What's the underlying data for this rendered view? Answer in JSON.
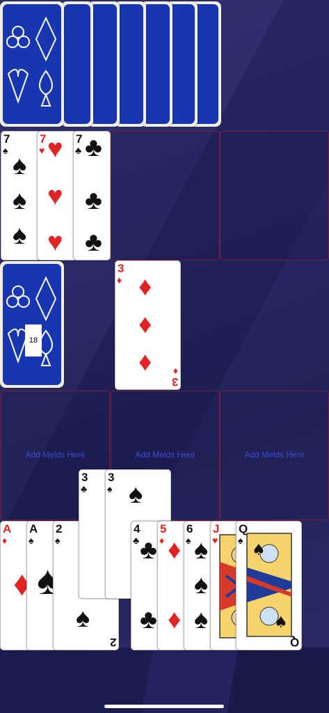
{
  "opponent": {
    "hand_card_count": 8
  },
  "melds": {
    "top_row": [
      {
        "cards": [
          {
            "rank": "7",
            "suit": "♠",
            "color": "black"
          },
          {
            "rank": "7",
            "suit": "♥",
            "color": "red"
          },
          {
            "rank": "7",
            "suit": "♣",
            "color": "black"
          }
        ]
      }
    ]
  },
  "stock": {
    "count": "18"
  },
  "discard": {
    "rank": "3",
    "suit": "♦",
    "color": "red"
  },
  "player_slots": [
    {
      "label": "Add Melds Here"
    },
    {
      "label": "Add Melds Here"
    },
    {
      "label": "Add Melds Here"
    }
  ],
  "hand": [
    {
      "rank": "A",
      "suit": "♦",
      "color": "red"
    },
    {
      "rank": "A",
      "suit": "♠",
      "color": "black"
    },
    {
      "rank": "2",
      "suit": "♠",
      "color": "black"
    },
    {
      "rank": "3",
      "suit": "♣",
      "color": "black"
    },
    {
      "rank": "3",
      "suit": "♠",
      "color": "black"
    },
    {
      "rank": "4",
      "suit": "♣",
      "color": "black"
    },
    {
      "rank": "5",
      "suit": "♦",
      "color": "red"
    },
    {
      "rank": "6",
      "suit": "♠",
      "color": "black"
    },
    {
      "rank": "J",
      "suit": "♥",
      "color": "red"
    },
    {
      "rank": "Q",
      "suit": "♠",
      "color": "black"
    }
  ]
}
